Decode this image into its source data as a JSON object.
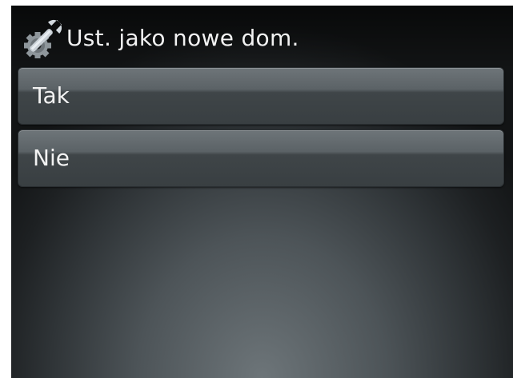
{
  "header": {
    "title": "Ust. jako nowe dom.",
    "icon": "settings-tools-icon"
  },
  "options": [
    {
      "label": "Tak"
    },
    {
      "label": "Nie"
    }
  ]
}
